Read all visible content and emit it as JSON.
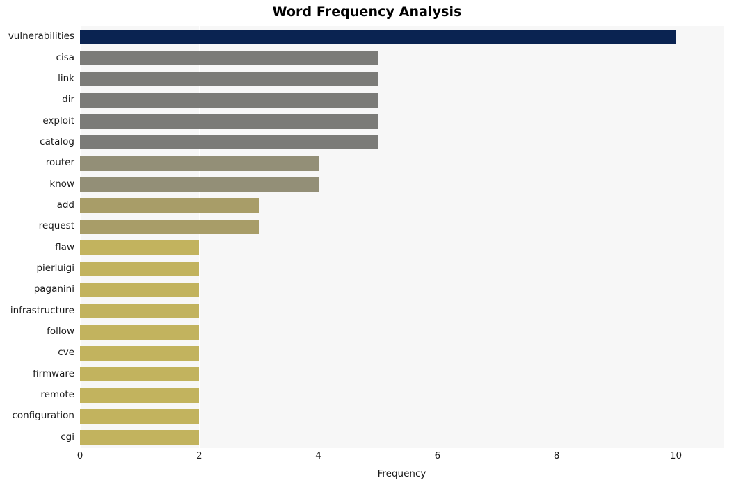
{
  "chart_data": {
    "type": "bar",
    "orientation": "horizontal",
    "title": "Word Frequency Analysis",
    "xlabel": "Frequency",
    "ylabel": "",
    "categories": [
      "vulnerabilities",
      "cisa",
      "link",
      "dir",
      "exploit",
      "catalog",
      "router",
      "know",
      "add",
      "request",
      "flaw",
      "pierluigi",
      "paganini",
      "infrastructure",
      "follow",
      "cve",
      "firmware",
      "remote",
      "configuration",
      "cgi"
    ],
    "values": [
      10,
      5,
      5,
      5,
      5,
      5,
      4,
      4,
      3,
      3,
      2,
      2,
      2,
      2,
      2,
      2,
      2,
      2,
      2,
      2
    ],
    "bar_colors": [
      "#0a2351",
      "#7b7b78",
      "#7b7b78",
      "#7b7b78",
      "#7b7b78",
      "#7b7b78",
      "#938f77",
      "#938f77",
      "#a89d68",
      "#a89d68",
      "#c2b35e",
      "#c2b35e",
      "#c2b35e",
      "#c2b35e",
      "#c2b35e",
      "#c2b35e",
      "#c2b35e",
      "#c2b35e",
      "#c2b35e",
      "#c2b35e"
    ],
    "xlim": [
      0,
      10.8
    ],
    "xticks": [
      0,
      2,
      4,
      6,
      8,
      10
    ],
    "xtick_labels": [
      "0",
      "2",
      "4",
      "6",
      "8",
      "10"
    ],
    "grid": true,
    "grid_axis": "x",
    "grid_color": "#ffffff",
    "plot_background": "#f7f7f7",
    "figure_background": "#ffffff",
    "legend": null,
    "legend_position": "none"
  }
}
